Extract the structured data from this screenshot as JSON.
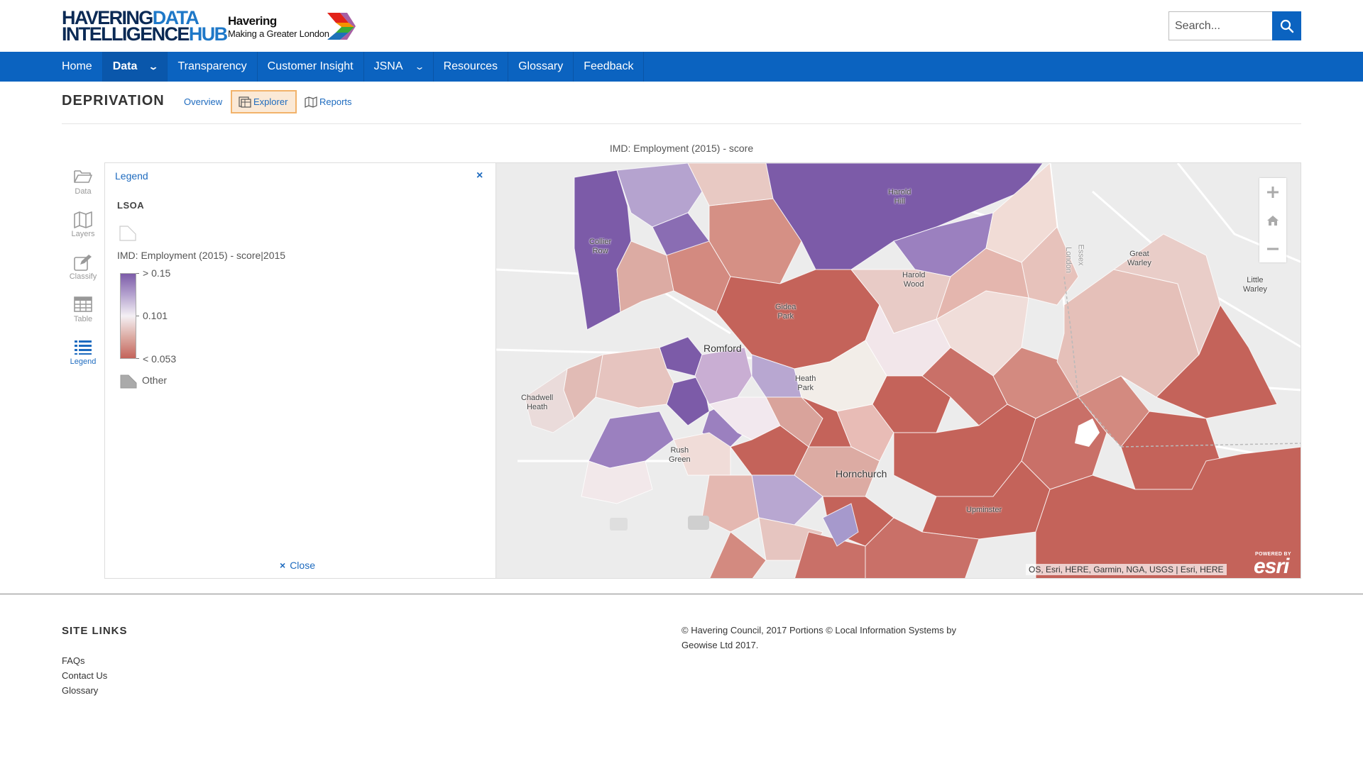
{
  "header": {
    "logo_line1_dark": "HAVERING",
    "logo_line1_blue": "DATA",
    "logo_line2_dark": "INTELLIGENCE",
    "logo_line2_blue": "HUB",
    "council_name": "Havering",
    "council_tagline": "Making a Greater London",
    "search_placeholder": "Search..."
  },
  "nav": {
    "items": [
      {
        "label": "Home"
      },
      {
        "label": "Data",
        "chevron": "⌄"
      },
      {
        "label": "Transparency"
      },
      {
        "label": "Customer Insight"
      },
      {
        "label": "JSNA",
        "chevron": "⌄"
      },
      {
        "label": "Resources"
      },
      {
        "label": "Glossary"
      },
      {
        "label": "Feedback"
      }
    ]
  },
  "page": {
    "title": "DEPRIVATION",
    "tabs": {
      "overview": "Overview",
      "explorer": "Explorer",
      "reports": "Reports"
    },
    "map_title": "IMD: Employment (2015) - score"
  },
  "tools": {
    "data": "Data",
    "layers": "Layers",
    "classify": "Classify",
    "table": "Table",
    "legend": "Legend"
  },
  "legend": {
    "heading": "Legend",
    "close_icon": "×",
    "layer": "LSOA",
    "field": "IMD: Employment (2015) - score|2015",
    "high": "> 0.15",
    "mid": "0.101",
    "low": "< 0.053",
    "other": "Other",
    "close_label": "Close",
    "colors": {
      "high": "#7c5ba8",
      "mid": "#f4f0f4",
      "low": "#c4635a"
    }
  },
  "map": {
    "places": {
      "harold_hill": "Harold\nHill",
      "collier_row": "Collier\nRow",
      "great_warley": "Great\nWarley",
      "little_warley": "Little\nWarley",
      "harold_wood": "Harold\nWood",
      "gidea_park": "Gidea\nPark",
      "romford": "Romford",
      "heath_park": "Heath\nPark",
      "chadwell_heath": "Chadwell\nHeath",
      "rush_green": "Rush\nGreen",
      "hornchurch": "Hornchurch",
      "upminster": "Upminster",
      "london": "London",
      "essex": "Essex"
    },
    "attribution": "OS, Esri, HERE, Garmin, NGA, USGS | Esri, HERE",
    "powered_by": "POWERED BY",
    "esri": "esri"
  },
  "footer": {
    "title": "SITE LINKS",
    "links": [
      "FAQs",
      "Contact Us",
      "Glossary"
    ],
    "copyright": "© Havering Council, 2017 Portions © Local Information Systems by Geowise Ltd 2017."
  }
}
